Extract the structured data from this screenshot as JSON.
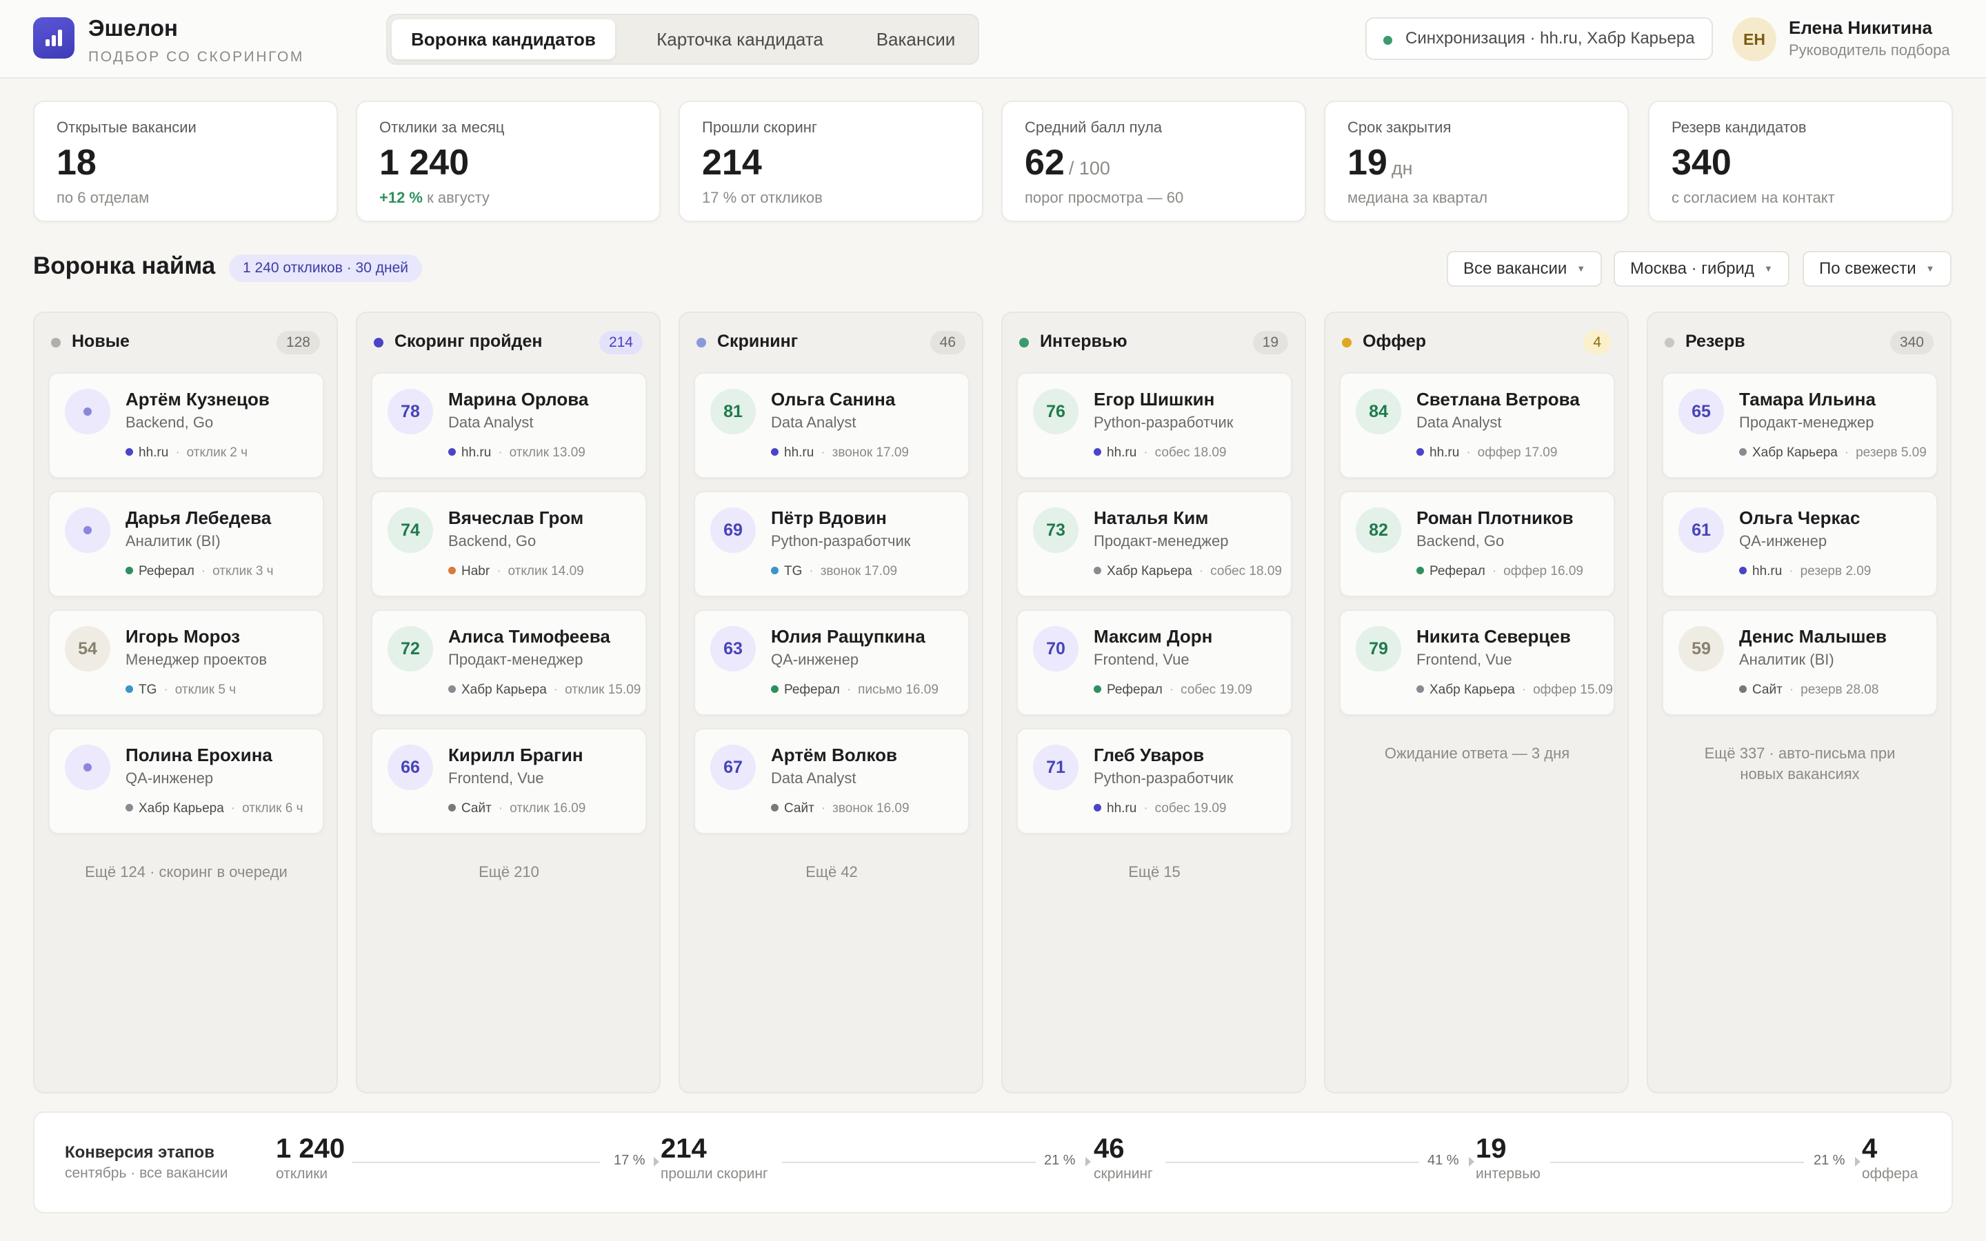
{
  "brand": {
    "name": "Эшелон",
    "subtitle": "ПОДБОР СО СКОРИНГОМ"
  },
  "tabs": [
    {
      "label": "Воронка кандидатов",
      "active": true
    },
    {
      "label": "Карточка кандидата",
      "active": false
    },
    {
      "label": "Вакансии",
      "active": false
    }
  ],
  "sync": {
    "label": "Синхронизация · hh.ru, Хабр Карьера",
    "status_color": "#3b9a6e"
  },
  "user": {
    "initials": "ЕН",
    "name": "Елена Никитина",
    "role": "Руководитель подбора"
  },
  "kpis": [
    {
      "label": "Открытые вакансии",
      "value": "18",
      "unit": "",
      "note": "по 6 отделам"
    },
    {
      "label": "Отклики за месяц",
      "value": "1 240",
      "unit": "",
      "note_positive": "+12 %",
      "note": "к августу"
    },
    {
      "label": "Прошли скоринг",
      "value": "214",
      "unit": "",
      "note": "17 % от откликов"
    },
    {
      "label": "Средний балл пула",
      "value": "62",
      "unit": "/ 100",
      "note": "порог просмотра — 60"
    },
    {
      "label": "Срок закрытия",
      "value": "19",
      "unit": "дн",
      "note": "медиана за квартал"
    },
    {
      "label": "Резерв кандидатов",
      "value": "340",
      "unit": "",
      "note": "с согласием на контакт"
    }
  ],
  "section": {
    "title": "Воронка найма",
    "badge": "1 240 откликов · 30 дней"
  },
  "filters": [
    {
      "label": "Все вакансии"
    },
    {
      "label": "Москва · гибрид"
    },
    {
      "label": "По свежести"
    }
  ],
  "source_colors": {
    "hh.ru": "#4a44c8",
    "Реферал": "#2f8f5f",
    "TG": "#3b95c8",
    "Хабр Карьера": "#8a8a92",
    "Habr": "#d97a3a",
    "Сайт": "#7a7a72"
  },
  "columns": [
    {
      "title": "Новые",
      "count": "128",
      "dot_color": "#b0afa8",
      "count_bg": "#e4e3de",
      "count_color": "#6a6a66",
      "more": "Ещё 124 · скоринг в очереди",
      "cards": [
        {
          "score": "",
          "score_style": "pending",
          "name": "Артём Кузнецов",
          "role": "Backend, Go",
          "source": "hh.ru",
          "meta": "отклик 2 ч"
        },
        {
          "score": "",
          "score_style": "pending",
          "name": "Дарья Лебедева",
          "role": "Аналитик (BI)",
          "source": "Реферал",
          "meta": "отклик 3 ч"
        },
        {
          "score": "54",
          "score_style": "beige",
          "name": "Игорь Мороз",
          "role": "Менеджер проектов",
          "source": "TG",
          "meta": "отклик 5 ч"
        },
        {
          "score": "",
          "score_style": "pending",
          "name": "Полина Ерохина",
          "role": "QA-инженер",
          "source": "Хабр Карьера",
          "meta": "отклик 6 ч"
        }
      ]
    },
    {
      "title": "Скоринг пройден",
      "count": "214",
      "dot_color": "#4a44c8",
      "count_bg": "#e4e2fa",
      "count_color": "#4743b8",
      "more": "Ещё 210",
      "cards": [
        {
          "score": "78",
          "score_style": "purple",
          "name": "Марина Орлова",
          "role": "Data Analyst",
          "source": "hh.ru",
          "meta": "отклик 13.09"
        },
        {
          "score": "74",
          "score_style": "green",
          "name": "Вячеслав Гром",
          "role": "Backend, Go",
          "source": "Habr",
          "meta": "отклик 14.09"
        },
        {
          "score": "72",
          "score_style": "green",
          "name": "Алиса Тимофеева",
          "role": "Продакт-менеджер",
          "source": "Хабр Карьера",
          "meta": "отклик 15.09"
        },
        {
          "score": "66",
          "score_style": "purple",
          "name": "Кирилл Брагин",
          "role": "Frontend, Vue",
          "source": "Сайт",
          "meta": "отклик 16.09"
        }
      ]
    },
    {
      "title": "Скрининг",
      "count": "46",
      "dot_color": "#8a9ad8",
      "count_bg": "#e4e3de",
      "count_color": "#6a6a66",
      "more": "Ещё 42",
      "cards": [
        {
          "score": "81",
          "score_style": "green",
          "name": "Ольга Санина",
          "role": "Data Analyst",
          "source": "hh.ru",
          "meta": "звонок 17.09"
        },
        {
          "score": "69",
          "score_style": "purple",
          "name": "Пётр Вдовин",
          "role": "Python-разработчик",
          "source": "TG",
          "meta": "звонок 17.09"
        },
        {
          "score": "63",
          "score_style": "purple",
          "name": "Юлия Ращупкина",
          "role": "QA-инженер",
          "source": "Реферал",
          "meta": "письмо 16.09"
        },
        {
          "score": "67",
          "score_style": "purple",
          "name": "Артём Волков",
          "role": "Data Analyst",
          "source": "Сайт",
          "meta": "звонок 16.09"
        }
      ]
    },
    {
      "title": "Интервью",
      "count": "19",
      "dot_color": "#3b9a6e",
      "count_bg": "#e4e3de",
      "count_color": "#6a6a66",
      "more": "Ещё 15",
      "cards": [
        {
          "score": "76",
          "score_style": "green",
          "name": "Егор Шишкин",
          "role": "Python-разработчик",
          "source": "hh.ru",
          "meta": "собес 18.09"
        },
        {
          "score": "73",
          "score_style": "green",
          "name": "Наталья Ким",
          "role": "Продакт-менеджер",
          "source": "Хабр Карьера",
          "meta": "собес 18.09"
        },
        {
          "score": "70",
          "score_style": "purple",
          "name": "Максим Дорн",
          "role": "Frontend, Vue",
          "source": "Реферал",
          "meta": "собес 19.09"
        },
        {
          "score": "71",
          "score_style": "purple",
          "name": "Глеб Уваров",
          "role": "Python-разработчик",
          "source": "hh.ru",
          "meta": "собес 19.09"
        }
      ]
    },
    {
      "title": "Оффер",
      "count": "4",
      "dot_color": "#e0a820",
      "count_bg": "#faf0cc",
      "count_color": "#8a6a10",
      "more": "Ожидание ответа — 3 дня",
      "cards": [
        {
          "score": "84",
          "score_style": "green",
          "name": "Светлана Ветрова",
          "role": "Data Analyst",
          "source": "hh.ru",
          "meta": "оффер 17.09"
        },
        {
          "score": "82",
          "score_style": "green",
          "name": "Роман Плотников",
          "role": "Backend, Go",
          "source": "Реферал",
          "meta": "оффер 16.09"
        },
        {
          "score": "79",
          "score_style": "green",
          "name": "Никита Северцев",
          "role": "Frontend, Vue",
          "source": "Хабр Карьера",
          "meta": "оффер 15.09"
        }
      ]
    },
    {
      "title": "Резерв",
      "count": "340",
      "dot_color": "#c8c7c0",
      "count_bg": "#e4e3de",
      "count_color": "#6a6a66",
      "more": "Ещё 337 · авто-письма при новых вакансиях",
      "cards": [
        {
          "score": "65",
          "score_style": "purple",
          "name": "Тамара Ильина",
          "role": "Продакт-менеджер",
          "source": "Хабр Карьера",
          "meta": "резерв 5.09"
        },
        {
          "score": "61",
          "score_style": "purple",
          "name": "Ольга Черкас",
          "role": "QA-инженер",
          "source": "hh.ru",
          "meta": "резерв 2.09"
        },
        {
          "score": "59",
          "score_style": "beige",
          "name": "Денис Малышев",
          "role": "Аналитик (BI)",
          "source": "Сайт",
          "meta": "резерв 28.08"
        }
      ]
    }
  ],
  "conversion": {
    "title": "Конверсия этапов",
    "subtitle": "сентябрь · все вакансии",
    "stages": [
      {
        "value": "1 240",
        "label": "отклики"
      },
      {
        "value": "214",
        "label": "прошли скоринг"
      },
      {
        "value": "46",
        "label": "скрининг"
      },
      {
        "value": "19",
        "label": "интервью"
      },
      {
        "value": "4",
        "label": "оффера"
      }
    ],
    "rates": [
      "17 %",
      "21 %",
      "41 %",
      "21 %"
    ]
  }
}
